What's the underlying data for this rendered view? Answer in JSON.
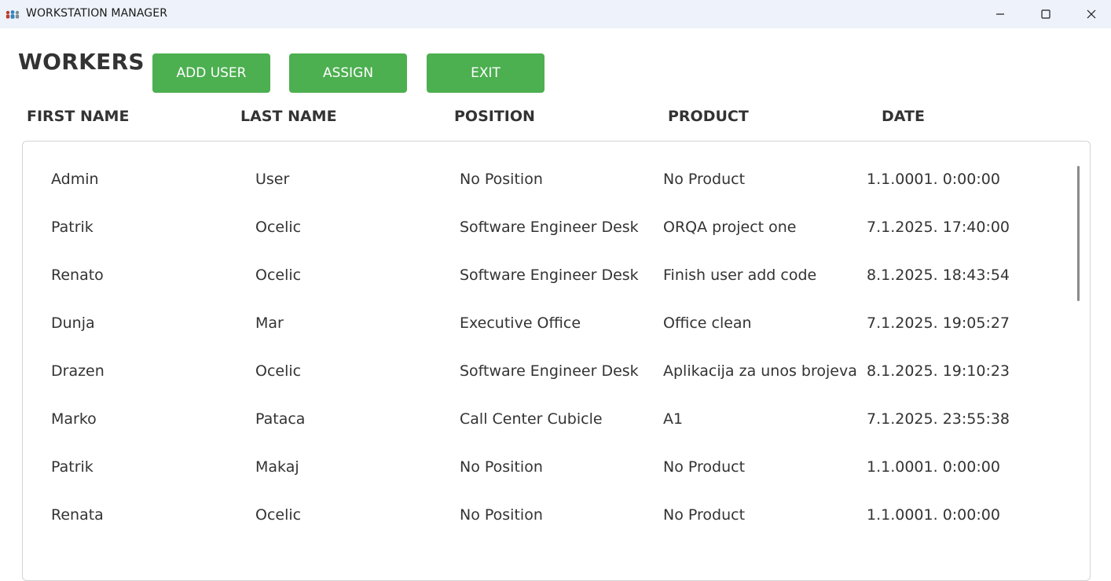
{
  "window": {
    "title": "WORKSTATION MANAGER"
  },
  "page": {
    "heading": "WORKERS"
  },
  "toolbar": {
    "add_user_label": "ADD USER",
    "assign_label": "ASSIGN",
    "exit_label": "EXIT"
  },
  "table": {
    "columns": [
      "FIRST NAME",
      "LAST NAME",
      "POSITION",
      "PRODUCT",
      "DATE"
    ],
    "rows": [
      [
        "Admin",
        "User",
        "No Position",
        "No Product",
        "1.1.0001. 0:00:00"
      ],
      [
        "Patrik",
        "Ocelic",
        "Software Engineer Desk",
        "ORQA project one",
        "7.1.2025. 17:40:00"
      ],
      [
        "Renato",
        "Ocelic",
        "Software Engineer Desk",
        "Finish user add code",
        "8.1.2025. 18:43:54"
      ],
      [
        "Dunja",
        "Mar",
        "Executive Office",
        "Office clean",
        "7.1.2025. 19:05:27"
      ],
      [
        "Drazen",
        "Ocelic",
        "Software Engineer Desk",
        "Aplikacija za unos brojeva",
        "8.1.2025. 19:10:23"
      ],
      [
        "Marko",
        "Pataca",
        "Call Center Cubicle",
        "A1",
        "7.1.2025. 23:55:38"
      ],
      [
        "Patrik",
        "Makaj",
        "No Position",
        "No Product",
        "1.1.0001. 0:00:00"
      ],
      [
        "Renata",
        "Ocelic",
        "No Position",
        "No Product",
        "1.1.0001. 0:00:00"
      ]
    ]
  },
  "colors": {
    "button": "#4caf50",
    "titlebar": "#eef2fa",
    "text": "#333333"
  },
  "icons": {
    "app": "people-icon",
    "minimize": "minimize-icon",
    "maximize": "maximize-icon",
    "close": "close-icon"
  }
}
